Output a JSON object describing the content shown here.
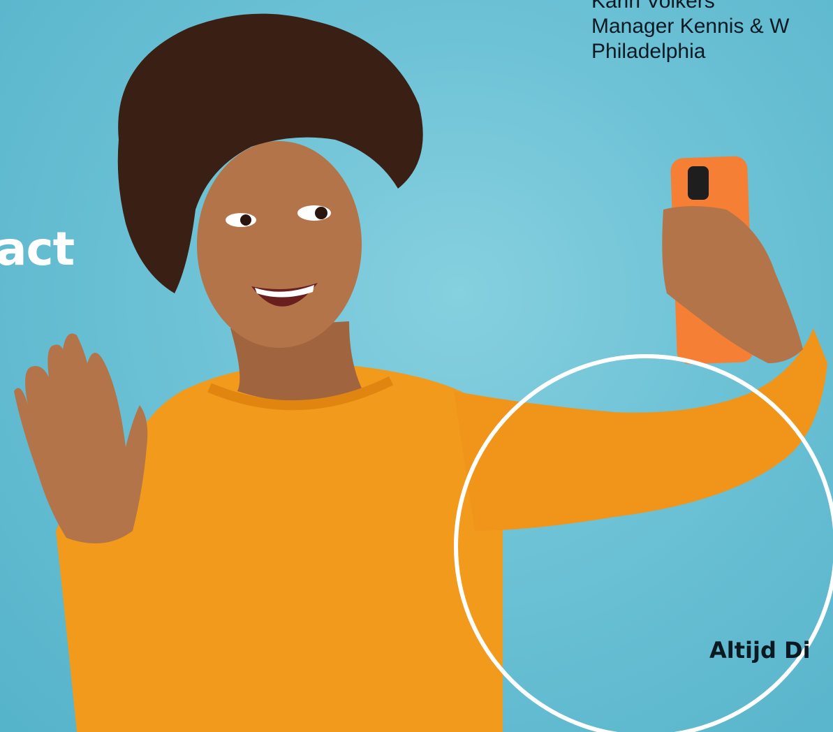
{
  "speaker": {
    "name": "Karin Volkers",
    "role": "Manager Kennis & W",
    "organisation": "Philadelphia"
  },
  "fragments": {
    "left_word": "act",
    "right_heading": "Altijd Di"
  },
  "photo": {
    "subject": "woman-taking-selfie",
    "background_color": "#6ec3d6",
    "sweater_color": "#f29a1c",
    "phone_color": "#f47f35",
    "ring_color": "#ffffff"
  }
}
